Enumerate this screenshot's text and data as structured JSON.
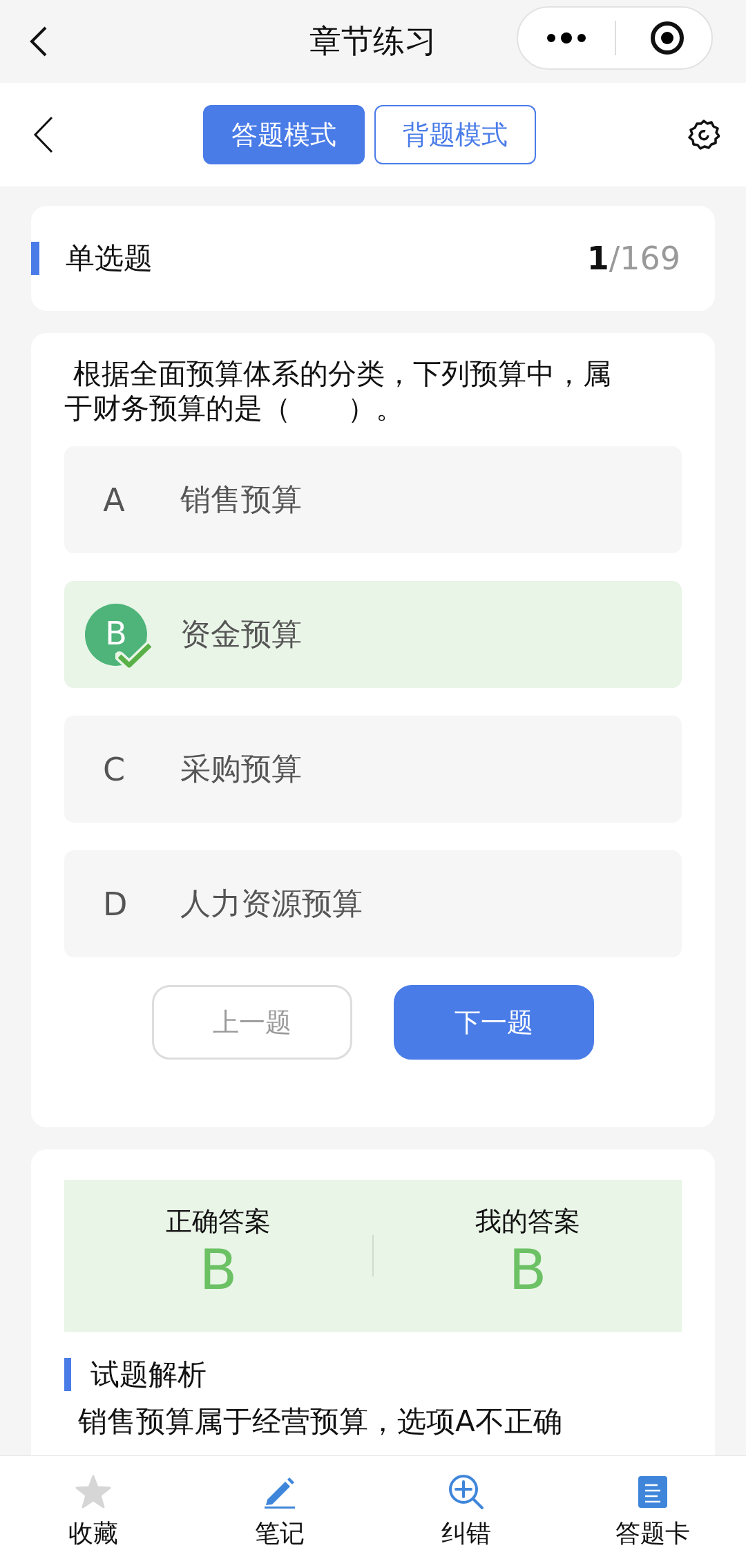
{
  "nav_bar": {
    "title": "章节练习"
  },
  "mode_tabs": [
    {
      "label": "答题模式",
      "selected": true
    },
    {
      "label": "背题模式",
      "selected": false
    }
  ],
  "question_header": {
    "type": "单选题",
    "counter": "**1**/169"
  },
  "question": {
    "text": " 根据全面预算体系的分类，下列预算中，属于财务预算的是（　　）。",
    "options": [
      {
        "letter": "A",
        "text": "销售预算",
        "selected": false
      },
      {
        "letter": "B",
        "text": "资金预算",
        "selected": true
      },
      {
        "letter": "C",
        "text": "采购预算",
        "selected": false
      },
      {
        "letter": "D",
        "text": "人力资源预算",
        "selected": false
      }
    ],
    "buttons": [
      {
        "label": "上一题",
        "disabled": true
      },
      {
        "label": "下一题",
        "disabled": false
      }
    ]
  },
  "result": {
    "correct_label": "正确答案",
    "correct": "B",
    "mine_label": "我的答案",
    "mine": "B"
  },
  "analysis": {
    "title": "试题解析",
    "text": "销售预算属于经营预算，选项A不正确"
  },
  "tab_bar": [
    {
      "kind": "favorite",
      "label": "收藏",
      "on": false
    },
    {
      "kind": "note",
      "label": "笔记"
    },
    {
      "kind": "report",
      "label": "纠错"
    },
    {
      "kind": "card",
      "label": "答题卡"
    }
  ]
}
